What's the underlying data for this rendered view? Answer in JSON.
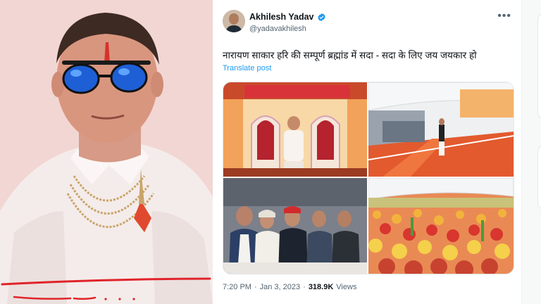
{
  "tweet": {
    "display_name": "Akhilesh Yadav",
    "handle": "@yadavakhilesh",
    "text": "नारायण साकार हरि की सम्पूर्ण ब्रह्मांड में सदा - सदा के लिए जय जयकार हो",
    "translate_label": "Translate post",
    "more_label": "•••",
    "time": "7:20 PM",
    "separator": "·",
    "date": "Jan 3, 2023",
    "views_count": "318.9K",
    "views_label": "Views"
  },
  "colors": {
    "verified": "#1d9bf0",
    "link": "#1d9bf0",
    "annotation": "#e0242a"
  },
  "icons": {
    "verified": "verified-badge-icon",
    "more": "more-options-icon"
  }
}
